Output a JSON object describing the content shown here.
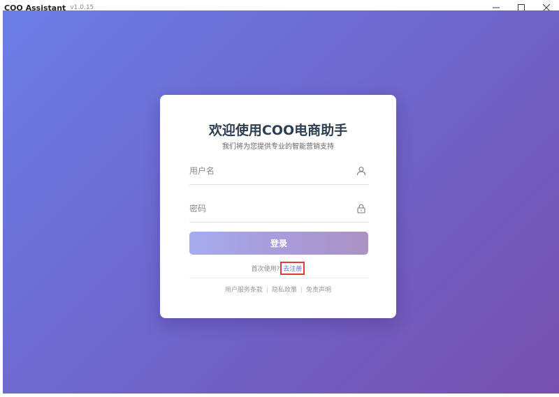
{
  "window": {
    "app_name": "COO Assistant",
    "version": "v1.0.15",
    "controls": [
      "minimize-icon",
      "maximize-icon",
      "close-icon"
    ]
  },
  "login": {
    "title": "欢迎使用COO电商助手",
    "subtitle": "我们将为您提供专业的智能营销支持",
    "username_placeholder": "用户名",
    "password_placeholder": "密码",
    "login_button": "登录",
    "first_use_text": "首次使用?",
    "register_link": "去注册",
    "footer": {
      "terms": "用户服务条款",
      "privacy": "隐私政策",
      "disclaimer": "免责声明",
      "separator": "|"
    }
  },
  "colors": {
    "bg_start": "#6b7ee6",
    "bg_end": "#7650ae",
    "title_text": "#2c3e50",
    "link": "#5a6fd0",
    "highlight_box": "#e03a3a"
  }
}
